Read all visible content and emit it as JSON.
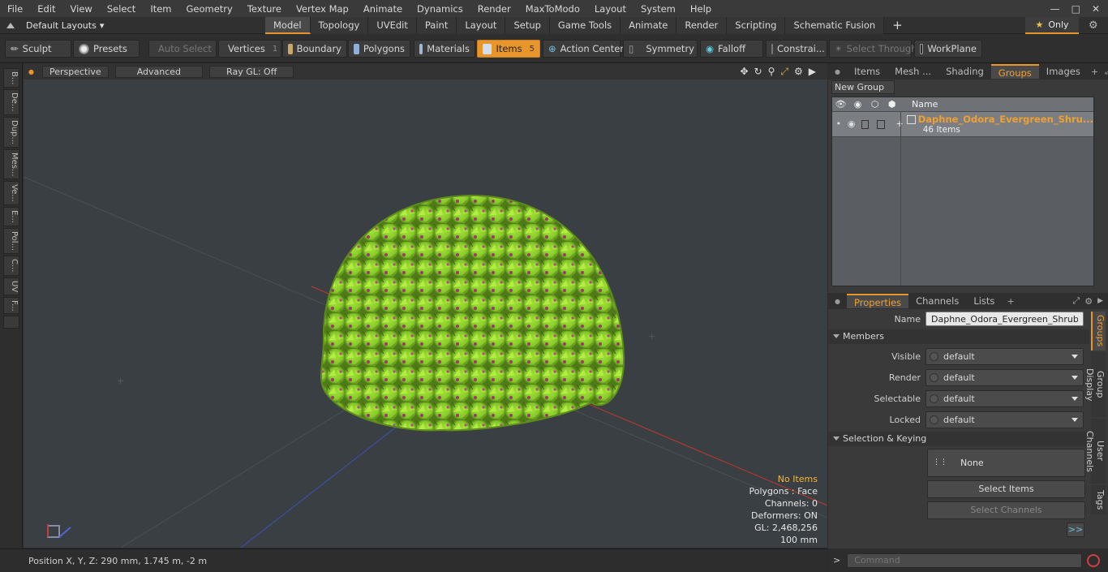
{
  "menu": {
    "items": [
      "File",
      "Edit",
      "View",
      "Select",
      "Item",
      "Geometry",
      "Texture",
      "Vertex Map",
      "Animate",
      "Dynamics",
      "Render",
      "MaxToModo",
      "Layout",
      "System",
      "Help"
    ]
  },
  "layouts": {
    "label": "Default Layouts"
  },
  "layout_tabs": [
    "Model",
    "Topology",
    "UVEdit",
    "Paint",
    "Layout",
    "Setup",
    "Game Tools",
    "Animate",
    "Render",
    "Scripting",
    "Schematic Fusion"
  ],
  "only_label": "Only",
  "toolbar": {
    "sculpt": "Sculpt",
    "presets": "Presets",
    "auto_select": "Auto Select",
    "vertices": "Vertices",
    "vertices_count": "1",
    "boundary": "Boundary",
    "polygons": "Polygons",
    "materials": "Materials",
    "items": "Items",
    "items_count": "5",
    "action_center": "Action Center",
    "symmetry": "Symmetry",
    "falloff": "Falloff",
    "constraints": "Constrai...",
    "select_through": "Select Through",
    "workplane": "WorkPlane"
  },
  "left_tabs": [
    "B...",
    "De...",
    "Dup...",
    "Mes...",
    "Ve...",
    "E...",
    "Pol...",
    "C...",
    "UV",
    "F..."
  ],
  "viewport": {
    "perspective": "Perspective",
    "advanced": "Advanced",
    "raygl": "Ray GL: Off",
    "stats": {
      "items": "No Items",
      "polygons": "Polygons : Face",
      "channels": "Channels: 0",
      "deformers": "Deformers: ON",
      "gl": "GL: 2,468,256",
      "scale": "100 mm"
    }
  },
  "status": {
    "position": "Position X, Y, Z:   290 mm, 1.745 m, -2 m"
  },
  "groups_panel": {
    "tabs": [
      "Items",
      "Mesh ...",
      "Shading",
      "Groups",
      "Images"
    ],
    "new_group": "New Group",
    "name_header": "Name",
    "group_name": "Daphne_Odora_Evergreen_Shru...",
    "group_count": "46 Items"
  },
  "properties": {
    "tabs": [
      "Properties",
      "Channels",
      "Lists"
    ],
    "name_label": "Name",
    "name_value": "Daphne_Odora_Evergreen_Shrub_wit",
    "members": "Members",
    "visible_label": "Visible",
    "visible": "default",
    "render_label": "Render",
    "render": "default",
    "selectable_label": "Selectable",
    "selectable": "default",
    "locked_label": "Locked",
    "locked": "default",
    "selection_keying": "Selection & Keying",
    "none": "None",
    "select_items": "Select Items",
    "select_channels": "Select Channels",
    "more": ">>",
    "side_tabs": [
      "Groups",
      "Group Display",
      "User Channels",
      "Tags"
    ]
  },
  "command": {
    "placeholder": "Command"
  },
  "colors": {
    "accent": "#e8952a",
    "shrub": "#8fd12a",
    "flower": "#9a3a6a"
  }
}
